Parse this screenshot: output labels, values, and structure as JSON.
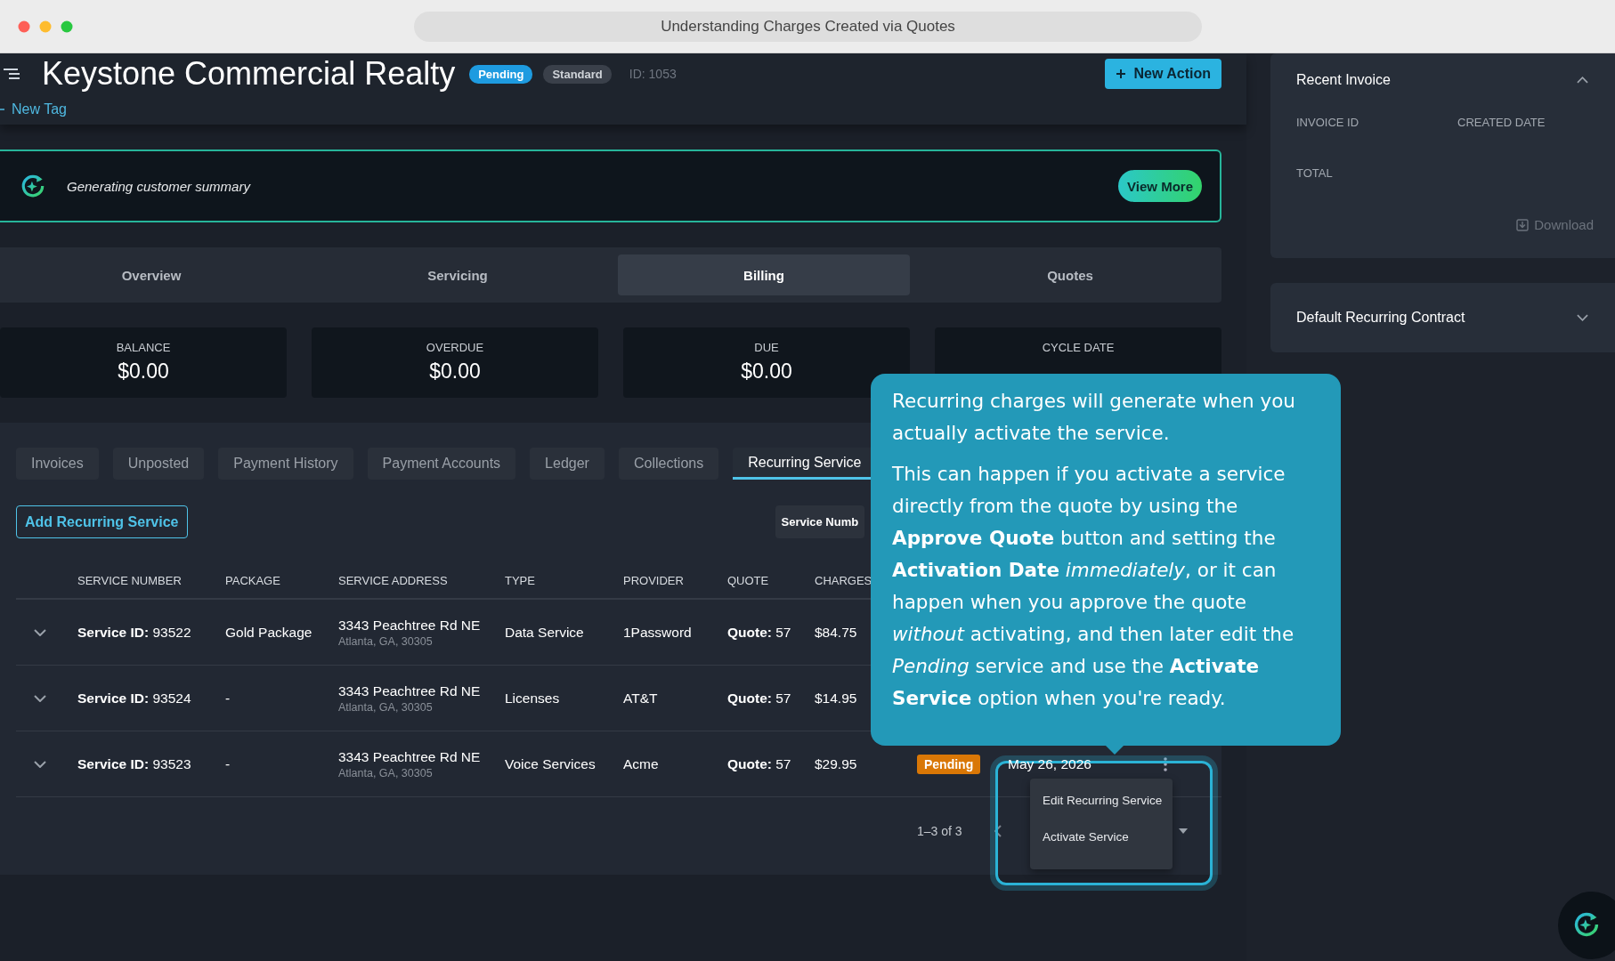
{
  "browser": {
    "title": "Understanding Charges Created via Quotes"
  },
  "header": {
    "title": "Keystone Commercial Realty",
    "badges": [
      {
        "label": "Pending",
        "kind": "status"
      },
      {
        "label": "Standard",
        "kind": "plan"
      }
    ],
    "id_text": "ID: 1053",
    "new_tag": "New Tag",
    "action_button": "New Action"
  },
  "banner": {
    "text": "Generating customer summary",
    "button": "View More"
  },
  "tabs": [
    {
      "label": "Overview",
      "selected": false
    },
    {
      "label": "Servicing",
      "selected": false
    },
    {
      "label": "Billing",
      "selected": true
    },
    {
      "label": "Quotes",
      "selected": false
    }
  ],
  "stats": [
    {
      "label": "BALANCE",
      "value": "$0.00"
    },
    {
      "label": "OVERDUE",
      "value": "$0.00"
    },
    {
      "label": "DUE",
      "value": "$0.00"
    },
    {
      "label": "CYCLE DATE"
    }
  ],
  "subtabs": [
    {
      "label": "Invoices",
      "selected": false
    },
    {
      "label": "Unposted",
      "selected": false
    },
    {
      "label": "Payment History",
      "selected": false
    },
    {
      "label": "Payment Accounts",
      "selected": false
    },
    {
      "label": "Ledger",
      "selected": false
    },
    {
      "label": "Collections",
      "selected": false
    },
    {
      "label": "Recurring Service",
      "selected": true
    }
  ],
  "add_button": "Add Recurring Service",
  "filter": {
    "label": "Service Numb"
  },
  "table": {
    "columns": [
      "SERVICE NUMBER",
      "PACKAGE",
      "SERVICE ADDRESS",
      "TYPE",
      "PROVIDER",
      "QUOTE",
      "CHARGES"
    ],
    "rows": [
      {
        "service": "**Service ID:** 93522",
        "package": "Gold Package",
        "address": "3343 Peachtree Rd NE",
        "city": "Atlanta, GA, 30305",
        "type": "Data Service",
        "provider": "1Password",
        "quote": "**Quote:** 57",
        "charges": "$84.75"
      },
      {
        "service": "**Service ID:** 93524",
        "package": "-",
        "address": "3343 Peachtree Rd NE",
        "city": "Atlanta, GA, 30305",
        "type": "Licenses",
        "provider": "AT&T",
        "quote": "**Quote:** 57",
        "charges": "$14.95"
      },
      {
        "service": "**Service ID:** 93523",
        "package": "-",
        "address": "3343 Peachtree Rd NE",
        "city": "Atlanta, GA, 30305",
        "type": "Voice Services",
        "provider": "Acme",
        "quote": "**Quote:** 57",
        "charges": "$29.95",
        "status": "Pending",
        "date": "May 26, 2026"
      }
    ]
  },
  "pagination": {
    "range": "1–3 of 3"
  },
  "menu": {
    "items": [
      "Edit Recurring Service",
      "Activate Service"
    ]
  },
  "tooltip": {
    "paragraphs": [
      "Recurring charges will generate when you actually activate the service.",
      "This can happen if you activate a service directly from the quote by using the **Approve Quote** button and setting the **Activation Date** *immediately*, or it can happen when you approve the quote *without* activating, and then later edit the *Pending* service and use the **Activate Service** option when you're ready."
    ]
  },
  "sidebar": {
    "recent_invoice": {
      "title": "Recent Invoice",
      "expanded": true,
      "fields": [
        "INVOICE ID",
        "CREATED DATE",
        "TOTAL"
      ],
      "download": "Download"
    },
    "contract": {
      "title": "Default Recurring Contract",
      "expanded": false
    }
  }
}
